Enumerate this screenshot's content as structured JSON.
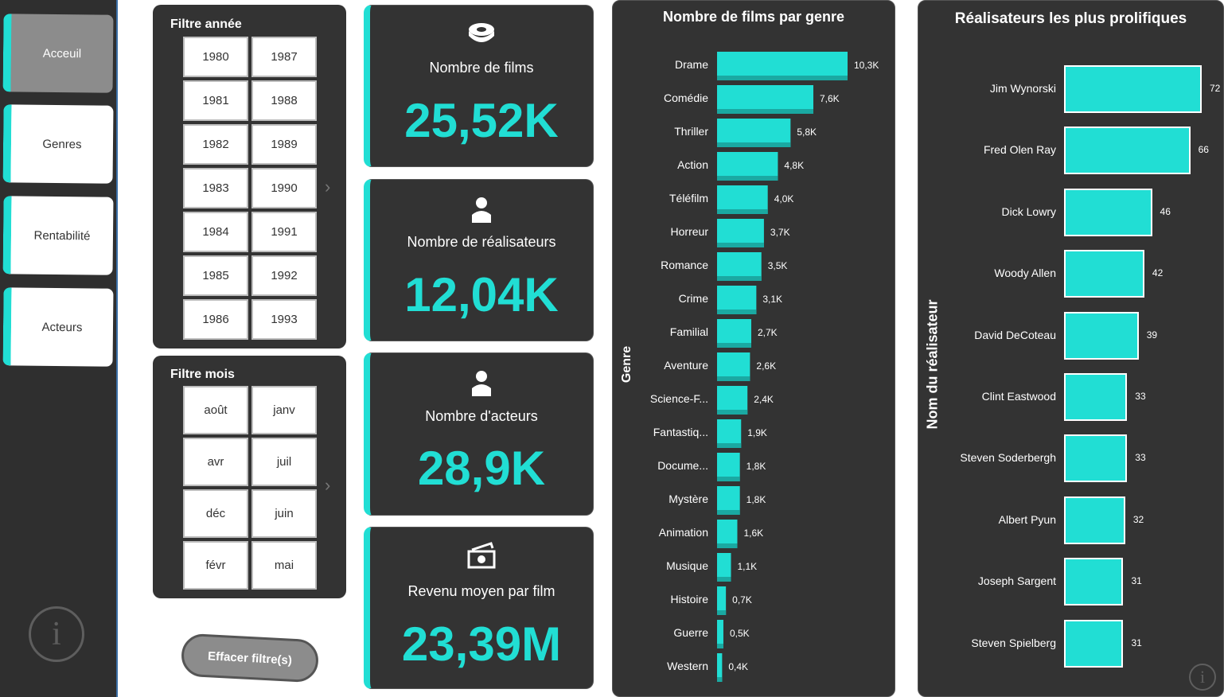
{
  "nav": {
    "items": [
      {
        "label": "Acceuil",
        "active": true
      },
      {
        "label": "Genres",
        "active": false
      },
      {
        "label": "Rentabilité",
        "active": false
      },
      {
        "label": "Acteurs",
        "active": false
      }
    ]
  },
  "year_filter": {
    "title": "Filtre année",
    "years": [
      "1980",
      "1987",
      "1981",
      "1988",
      "1982",
      "1989",
      "1983",
      "1990",
      "1984",
      "1991",
      "1985",
      "1992",
      "1986",
      "1993"
    ]
  },
  "month_filter": {
    "title": "Filtre mois",
    "months": [
      "août",
      "janv",
      "avr",
      "juil",
      "déc",
      "juin",
      "févr",
      "mai"
    ]
  },
  "clear_button": "Effacer filtre(s)",
  "kpis": [
    {
      "icon": "film-reel-icon",
      "label": "Nombre de films",
      "value": "25,52K"
    },
    {
      "icon": "person-icon",
      "label": "Nombre de réalisateurs",
      "value": "12,04K"
    },
    {
      "icon": "person-icon",
      "label": "Nombre d'acteurs",
      "value": "28,9K"
    },
    {
      "icon": "money-icon",
      "label": "Revenu moyen par film",
      "value": "23,39M"
    }
  ],
  "chart_data": [
    {
      "type": "bar",
      "title": "Nombre de films par genre",
      "ylabel": "Genre",
      "categories": [
        "Drame",
        "Comédie",
        "Thriller",
        "Action",
        "Téléfilm",
        "Horreur",
        "Romance",
        "Crime",
        "Familial",
        "Aventure",
        "Science-F...",
        "Fantastiq...",
        "Docume...",
        "Mystère",
        "Animation",
        "Musique",
        "Histoire",
        "Guerre",
        "Western"
      ],
      "values": [
        10300,
        7600,
        5800,
        4800,
        4000,
        3700,
        3500,
        3100,
        2700,
        2600,
        2400,
        1900,
        1800,
        1800,
        1600,
        1100,
        700,
        500,
        400
      ],
      "value_labels": [
        "10,3K",
        "7,6K",
        "5,8K",
        "4,8K",
        "4,0K",
        "3,7K",
        "3,5K",
        "3,1K",
        "2,7K",
        "2,6K",
        "2,4K",
        "1,9K",
        "1,8K",
        "1,8K",
        "1,6K",
        "1,1K",
        "0,7K",
        "0,5K",
        "0,4K"
      ],
      "color": "#21ded4"
    },
    {
      "type": "bar",
      "title": "Réalisateurs les plus prolifiques",
      "ylabel": "Nom du réalisateur",
      "categories": [
        "Jim Wynorski",
        "Fred Olen Ray",
        "Dick Lowry",
        "Woody Allen",
        "David DeCoteau",
        "Clint Eastwood",
        "Steven Soderbergh",
        "Albert Pyun",
        "Joseph Sargent",
        "Steven Spielberg"
      ],
      "values": [
        72,
        66,
        46,
        42,
        39,
        33,
        33,
        32,
        31,
        31
      ],
      "color": "#21ded4"
    }
  ],
  "colors": {
    "accent": "#21ded4",
    "panel": "#333333",
    "sidebar": "#2f2f2f"
  }
}
